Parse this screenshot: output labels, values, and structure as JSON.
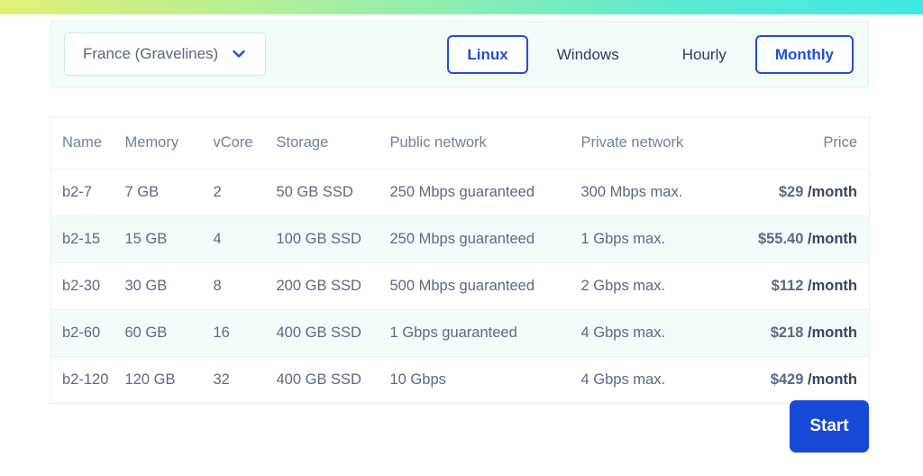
{
  "theme": {
    "gradient_start": "#e3f07a",
    "gradient_end": "#3ee9e4",
    "accent_blue": "#1f4fd8",
    "button_blue": "#1849d6",
    "text_muted": "#737f9e",
    "row_alt_bg": "#f4fcfa",
    "filter_bar_bg": "#f2fcfb"
  },
  "filter_bar": {
    "region": {
      "label": "France (Gravelines)",
      "chevron_icon": "chevron-down-icon"
    },
    "os_toggle": {
      "options": [
        "Linux",
        "Windows"
      ],
      "selected": "Linux"
    },
    "billing_toggle": {
      "options": [
        "Hourly",
        "Monthly"
      ],
      "selected": "Monthly"
    }
  },
  "table": {
    "columns": [
      "Name",
      "Memory",
      "vCore",
      "Storage",
      "Public network",
      "Private network",
      "Price"
    ],
    "rows": [
      {
        "name": "b2-7",
        "memory": "7 GB",
        "vcore": "2",
        "storage": "50 GB SSD",
        "public_network": "250 Mbps guaranteed",
        "private_network": "300 Mbps max.",
        "price": "$29",
        "price_period": "/month"
      },
      {
        "name": "b2-15",
        "memory": "15 GB",
        "vcore": "4",
        "storage": "100 GB SSD",
        "public_network": "250 Mbps guaranteed",
        "private_network": "1 Gbps max.",
        "price": "$55.40",
        "price_period": "/month"
      },
      {
        "name": "b2-30",
        "memory": "30 GB",
        "vcore": "8",
        "storage": "200 GB SSD",
        "public_network": "500 Mbps guaranteed",
        "private_network": "2 Gbps max.",
        "price": "$112",
        "price_period": "/month"
      },
      {
        "name": "b2-60",
        "memory": "60 GB",
        "vcore": "16",
        "storage": "400 GB SSD",
        "public_network": "1 Gbps guaranteed",
        "private_network": "4 Gbps max.",
        "price": "$218",
        "price_period": "/month"
      },
      {
        "name": "b2-120",
        "memory": "120 GB",
        "vcore": "32",
        "storage": "400 GB SSD",
        "public_network": "10 Gbps",
        "private_network": "4 Gbps max.",
        "price": "$429",
        "price_period": "/month"
      }
    ]
  },
  "actions": {
    "start_label": "Start"
  }
}
